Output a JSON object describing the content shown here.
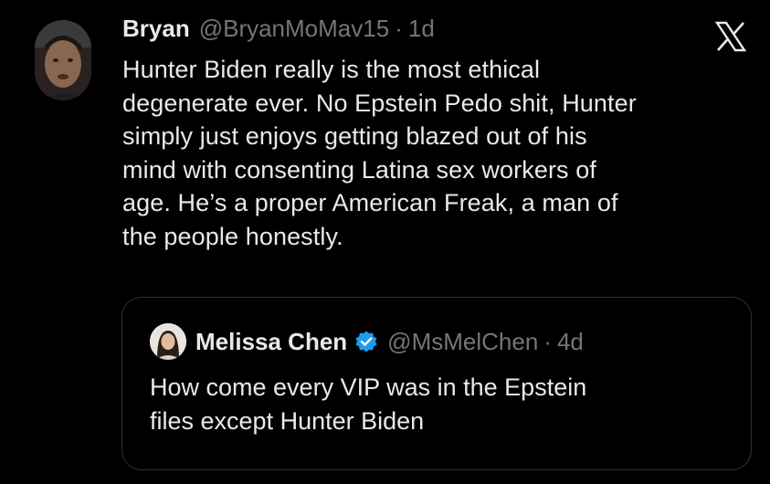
{
  "tweet": {
    "author_name": "Bryan",
    "author_handle": "@BryanMoMav15",
    "separator": "·",
    "time": "1d",
    "text_lines": [
      "Hunter Biden really is the most ethical",
      "degenerate ever. No Epstein Pedo shit, Hunter",
      "simply just enjoys getting blazed out of his",
      "mind with consenting Latina sex workers of",
      "age. He’s a proper American Freak, a man of",
      "the people honestly."
    ],
    "avatar_icon": "profile-photo",
    "logo_icon": "x-logo-icon"
  },
  "quote": {
    "author_name": "Melissa Chen",
    "author_handle": "@MsMelChen",
    "separator": "·",
    "time": "4d",
    "verified_icon": "verified-badge-icon",
    "text_lines": [
      "How come every VIP was in the Epstein",
      "files except Hunter Biden"
    ]
  },
  "colors": {
    "background": "#000000",
    "text_primary": "#e7e9ea",
    "text_secondary": "#71767b",
    "border": "#2f3336",
    "verified_blue": "#1d9bf0"
  }
}
